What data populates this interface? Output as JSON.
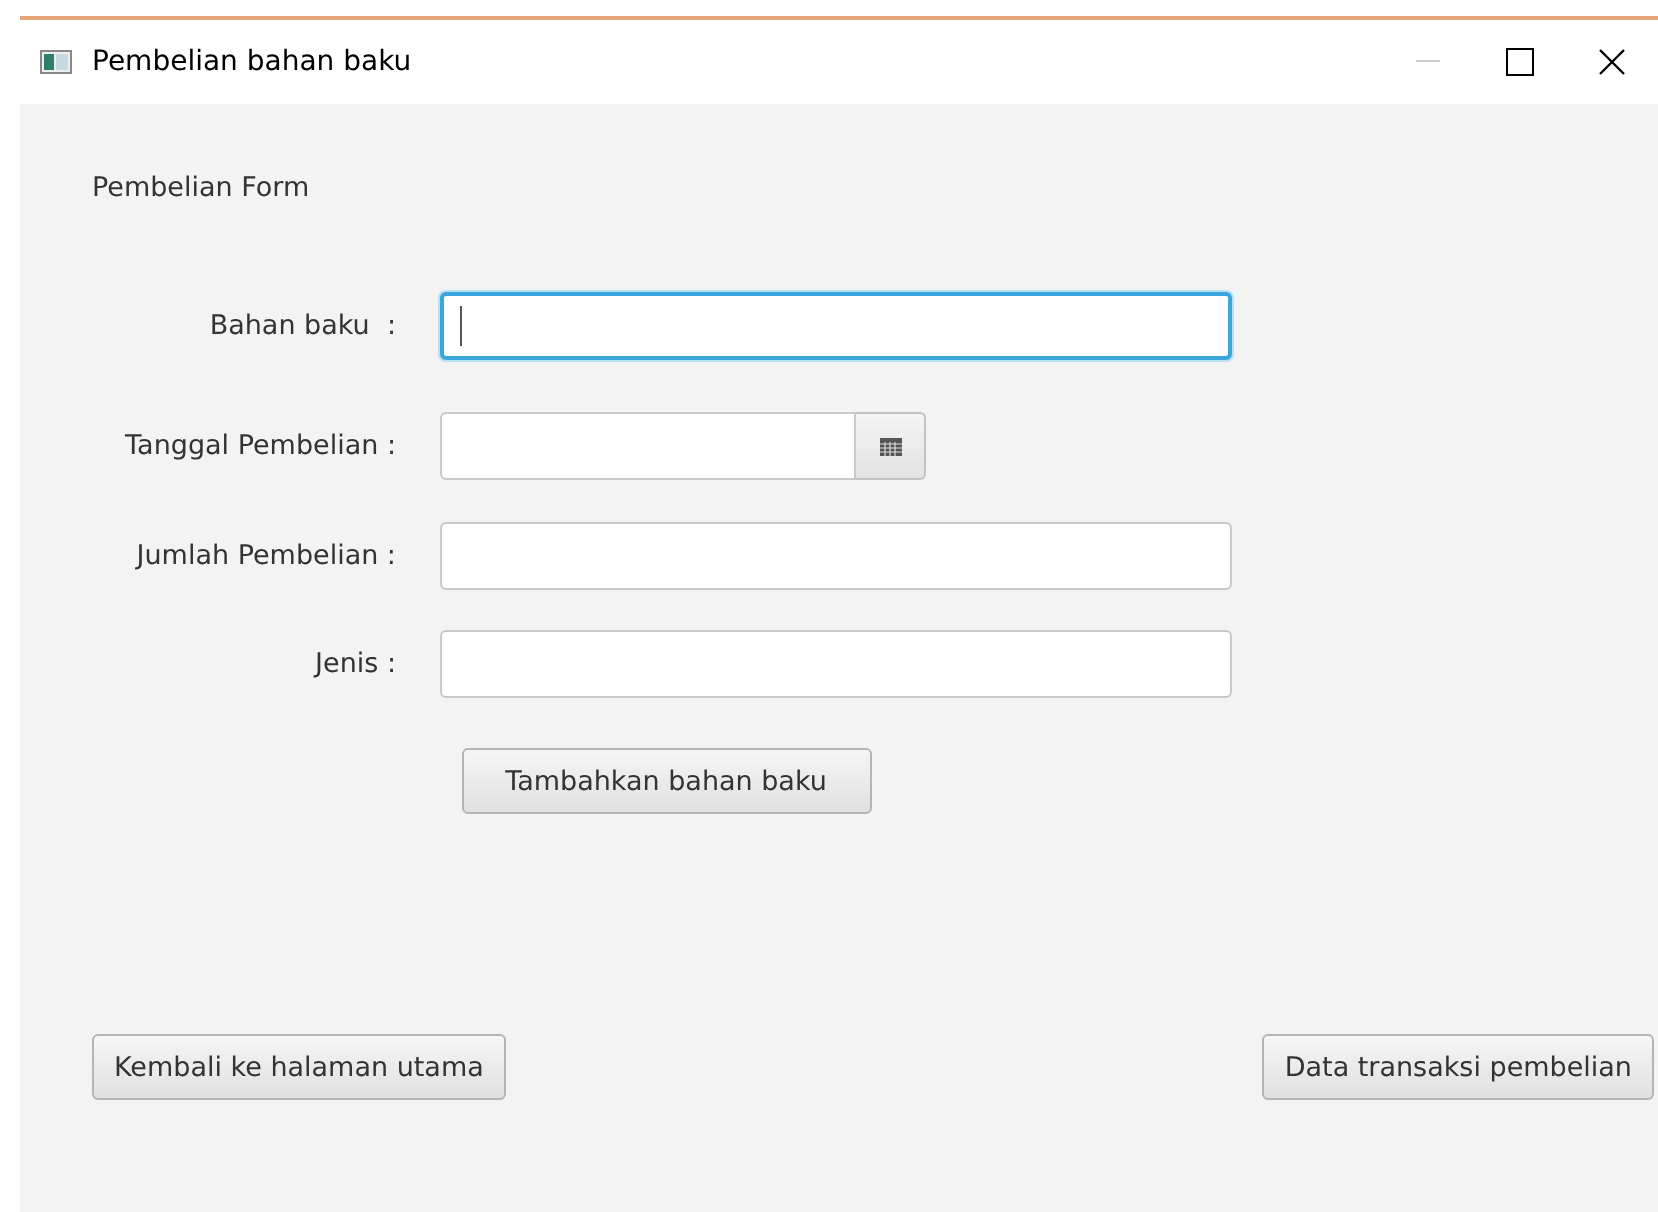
{
  "window": {
    "title": "Pembelian bahan baku"
  },
  "form": {
    "heading": "Pembelian Form",
    "fields": [
      {
        "kind": "text",
        "label": "Bahan baku  :",
        "focused": true
      },
      {
        "kind": "date",
        "label": "Tanggal Pembelian :",
        "focused": false
      },
      {
        "kind": "text",
        "label": "Jumlah Pembelian :",
        "focused": false
      },
      {
        "kind": "text",
        "label": "Jenis :",
        "focused": false
      }
    ],
    "submit": "Tambahkan bahan baku"
  },
  "footer_buttons": [
    "Kembali ke halaman utama",
    "Data transaksi pembelian"
  ]
}
